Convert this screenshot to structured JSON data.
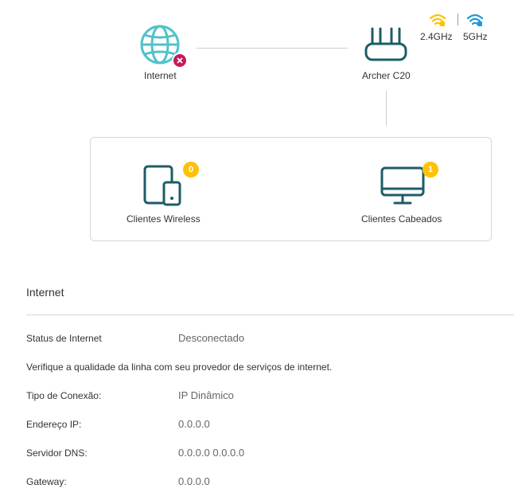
{
  "topology": {
    "internet": {
      "label": "Internet",
      "status_icon": "error-x-icon"
    },
    "router": {
      "label": "Archer C20"
    },
    "bands": [
      {
        "label": "2.4GHz",
        "color": "#ffc107"
      },
      {
        "label": "5GHz",
        "color": "#1e9ad6"
      }
    ],
    "clients": {
      "wireless": {
        "label": "Clientes Wireless",
        "count": "0"
      },
      "wired": {
        "label": "Clientes Cabeados",
        "count": "1"
      }
    }
  },
  "internet_section": {
    "title": "Internet",
    "status_label": "Status de Internet",
    "status_value": "Desconectado",
    "notice": "Verifique a qualidade da linha com seu provedor de serviços de internet.",
    "rows": [
      {
        "label": "Tipo de Conexão:",
        "value": "IP Dinâmico"
      },
      {
        "label": "Endereço IP:",
        "value": "0.0.0.0"
      },
      {
        "label": "Servidor DNS:",
        "value": "0.0.0.0 0.0.0.0"
      },
      {
        "label": "Gateway:",
        "value": "0.0.0.0"
      }
    ]
  },
  "colors": {
    "icon_teal": "#1d5c67",
    "globe_teal": "#4fc3c9",
    "error_red": "#c8195b",
    "badge_yellow": "#ffc107",
    "wifi_blue": "#1e9ad6"
  }
}
